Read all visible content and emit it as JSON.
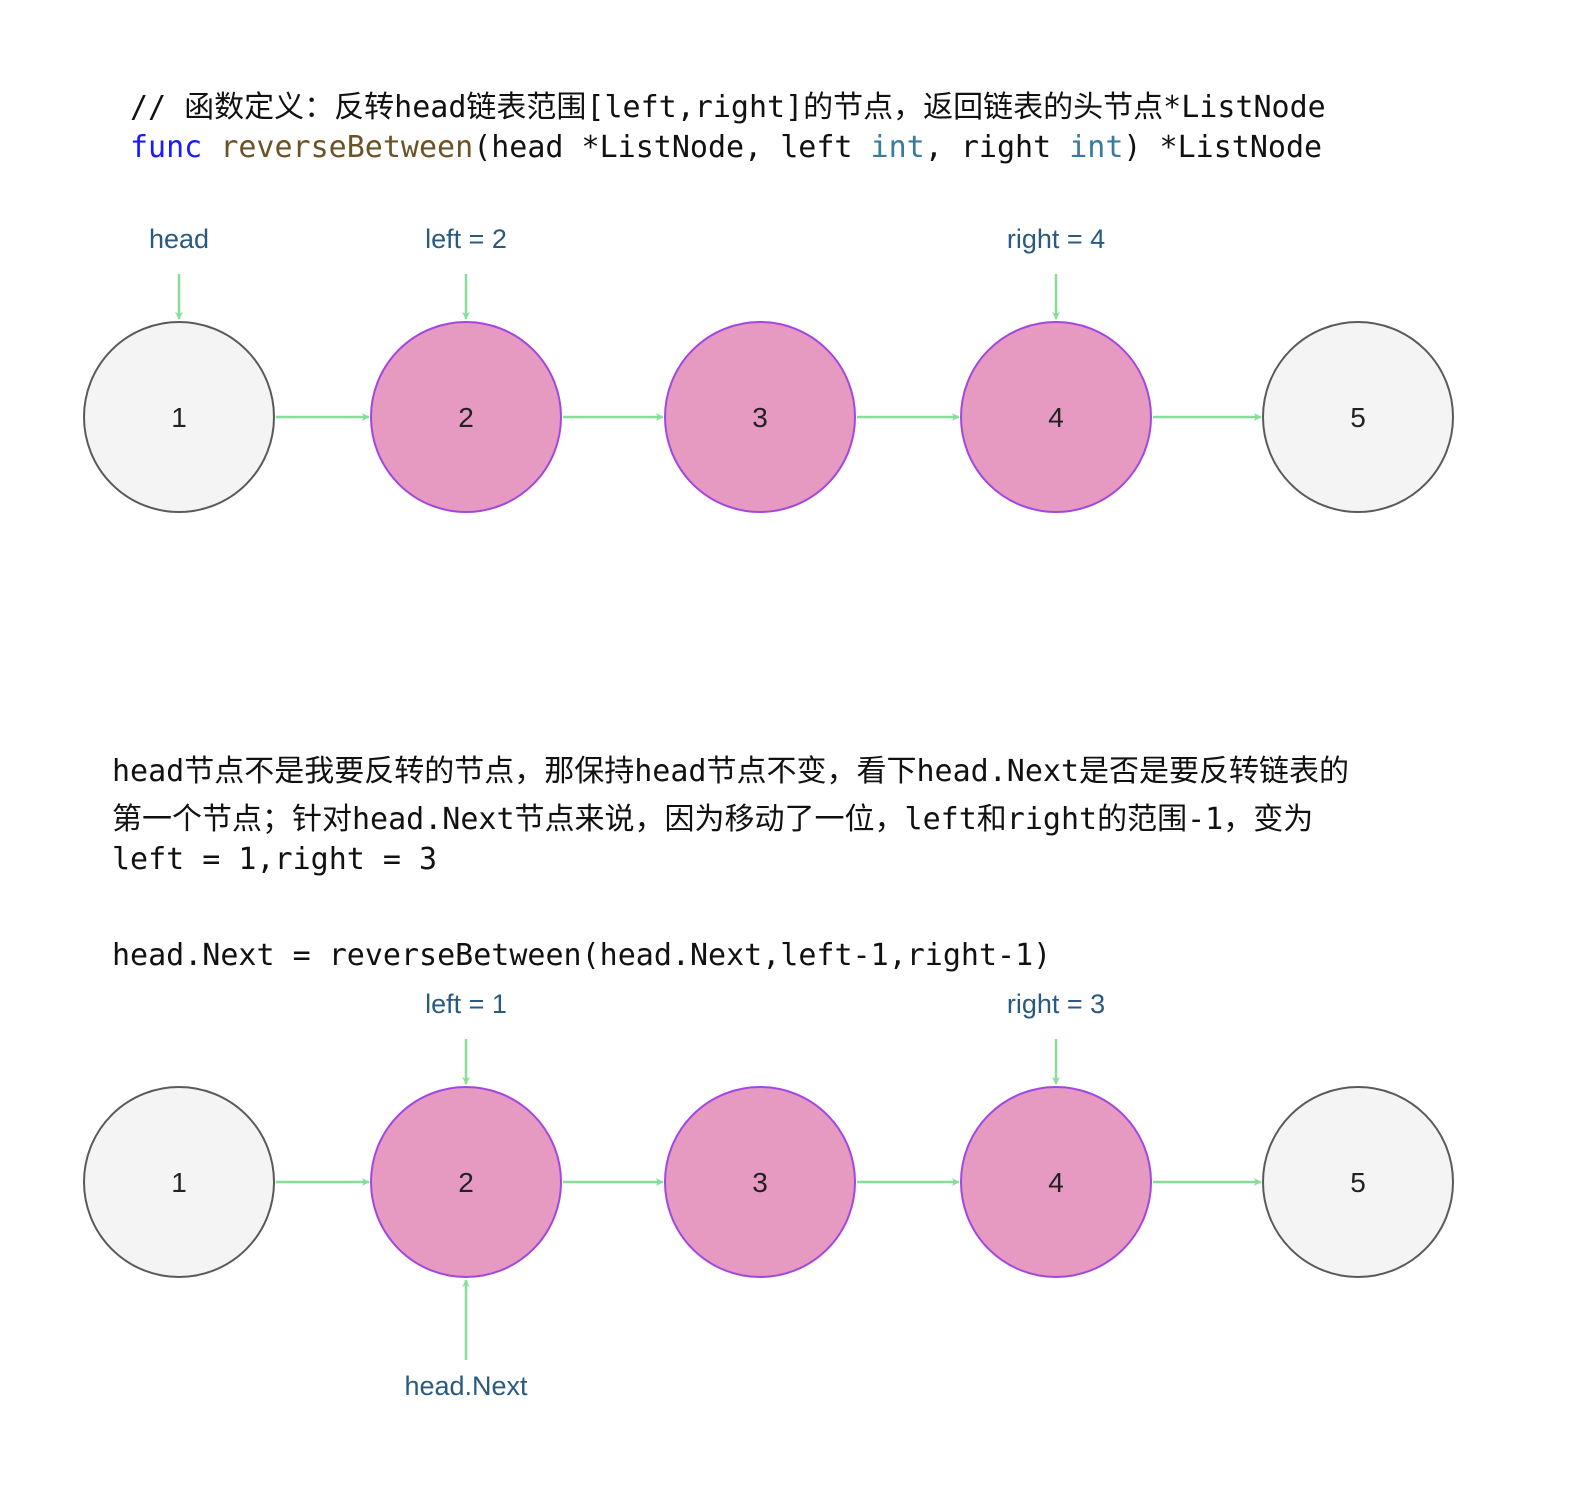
{
  "code": {
    "comment": "// 函数定义：反转head链表范围[left,right]的节点，返回链表的头节点*ListNode",
    "keyword": "func",
    "func_name": "reverseBetween",
    "sig_part1": "(head *ListNode, left ",
    "type1": "int",
    "sig_part2": ", right ",
    "type2": "int",
    "sig_part3": ") *ListNode"
  },
  "diagram1": {
    "nodes": [
      {
        "value": "1",
        "highlighted": false
      },
      {
        "value": "2",
        "highlighted": true
      },
      {
        "value": "3",
        "highlighted": true
      },
      {
        "value": "4",
        "highlighted": true
      },
      {
        "value": "5",
        "highlighted": false
      }
    ],
    "pointers": [
      {
        "label": "head",
        "node": 0
      },
      {
        "label": "left = 2",
        "node": 1
      },
      {
        "label": "right = 4",
        "node": 3
      }
    ]
  },
  "explanation": {
    "line1": "head节点不是我要反转的节点，那保持head节点不变，看下head.Next是否是要反转链表的",
    "line2": "第一个节点；针对head.Next节点来说，因为移动了一位，left和right的范围-1，变为",
    "line3": "left = 1,right = 3",
    "line4": "head.Next = reverseBetween(head.Next,left-1,right-1)"
  },
  "diagram2": {
    "nodes": [
      {
        "value": "1",
        "highlighted": false
      },
      {
        "value": "2",
        "highlighted": true
      },
      {
        "value": "3",
        "highlighted": true
      },
      {
        "value": "4",
        "highlighted": true
      },
      {
        "value": "5",
        "highlighted": false
      }
    ],
    "pointers": [
      {
        "label": "left = 1",
        "node": 1
      },
      {
        "label": "right = 3",
        "node": 3
      }
    ],
    "bottom_pointer": {
      "label": "head.Next",
      "node": 1
    }
  },
  "colors": {
    "highlight_fill": "#e699c1",
    "highlight_stroke": "#a346e0",
    "normal_fill": "#f4f4f4",
    "normal_stroke": "#5a5a5a",
    "arrow": "#88dd99",
    "label": "#2a5a80"
  }
}
